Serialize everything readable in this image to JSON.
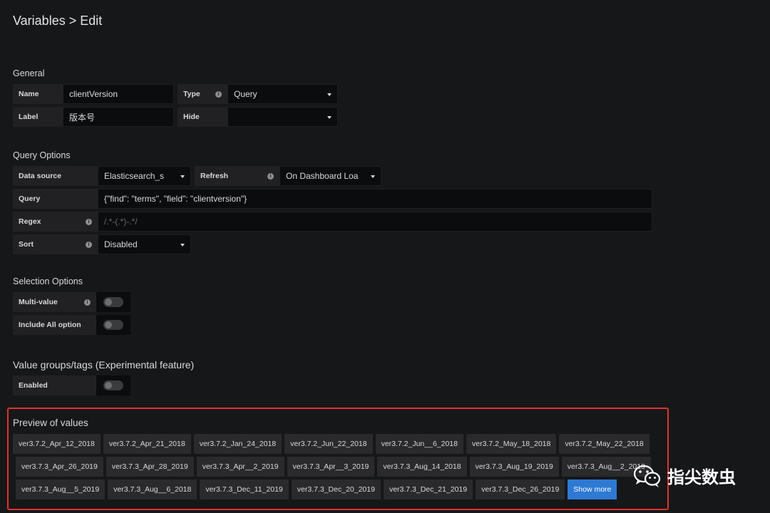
{
  "header": {
    "title": "Variables > Edit"
  },
  "general": {
    "title": "General",
    "name_label": "Name",
    "name_value": "clientVersion",
    "type_label": "Type",
    "type_value": "Query",
    "label_label": "Label",
    "label_value": "版本号",
    "hide_label": "Hide",
    "hide_value": ""
  },
  "query_options": {
    "title": "Query Options",
    "datasource_label": "Data source",
    "datasource_value": "Elasticsearch_s",
    "refresh_label": "Refresh",
    "refresh_value": "On Dashboard Loa",
    "query_label": "Query",
    "query_value": "{\"find\": \"terms\", \"field\": \"clientversion\"}",
    "regex_label": "Regex",
    "regex_placeholder": "/.*-(.*)-.*/",
    "sort_label": "Sort",
    "sort_value": "Disabled"
  },
  "selection_options": {
    "title": "Selection Options",
    "multi_value_label": "Multi-value",
    "multi_value_on": false,
    "include_all_label": "Include All option",
    "include_all_on": false
  },
  "value_groups": {
    "title": "Value groups/tags (Experimental feature)",
    "enabled_label": "Enabled",
    "enabled_on": false
  },
  "preview": {
    "title": "Preview of values",
    "rows": [
      [
        "ver3.7.2_Apr_12_2018",
        "ver3.7.2_Apr_21_2018",
        "ver3.7.2_Jan_24_2018",
        "ver3.7.2_Jun_22_2018",
        "ver3.7.2_Jun__6_2018",
        "ver3.7.2_May_18_2018",
        "ver3.7.2_May_22_2018"
      ],
      [
        "ver3.7.3_Apr_26_2019",
        "ver3.7.3_Apr_28_2019",
        "ver3.7.3_Apr__2_2019",
        "ver3.7.3_Apr__3_2019",
        "ver3.7.3_Aug_14_2018",
        "ver3.7.3_Aug_19_2019",
        "ver3.7.3_Aug__2_2019"
      ],
      [
        "ver3.7.3_Aug__5_2019",
        "ver3.7.3_Aug__6_2018",
        "ver3.7.3_Dec_11_2019",
        "ver3.7.3_Dec_20_2019",
        "ver3.7.3_Dec_21_2019",
        "ver3.7.3_Dec_26_2019"
      ]
    ],
    "show_more_label": "Show more"
  },
  "watermark": {
    "text": "指尖数虫",
    "icon": "wechat-icon"
  },
  "colors": {
    "background": "#161719",
    "accent": "#2e79d3",
    "highlight_border": "#e0332a"
  }
}
